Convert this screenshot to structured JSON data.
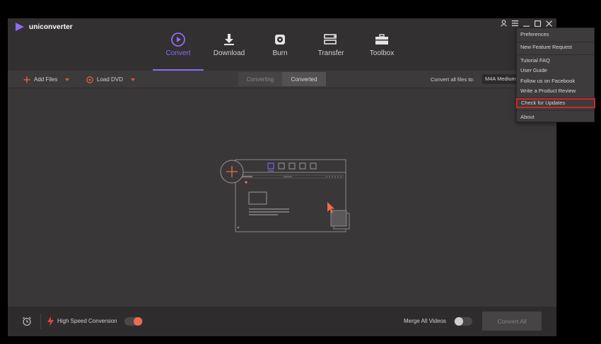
{
  "app": {
    "name": "uniconverter"
  },
  "nav": {
    "items": [
      {
        "label": "Convert",
        "icon": "play-circle-icon",
        "active": true
      },
      {
        "label": "Download",
        "icon": "download-icon"
      },
      {
        "label": "Burn",
        "icon": "disc-icon"
      },
      {
        "label": "Transfer",
        "icon": "transfer-icon"
      },
      {
        "label": "Toolbox",
        "icon": "toolbox-icon"
      }
    ]
  },
  "window_controls": [
    "user-icon",
    "menu-icon",
    "minimize-icon",
    "maximize-icon",
    "close-icon"
  ],
  "toolbar": {
    "add_files": "Add Files",
    "load_dvd": "Load DVD",
    "tabs": [
      "Converting",
      "Converted"
    ],
    "active_tab": "Converted",
    "convert_all_to_label": "Convert all files to:",
    "format_value": "M4A Medium"
  },
  "bottom": {
    "high_speed_label": "High Speed Conversion",
    "high_speed_on": true,
    "merge_label": "Merge All Videos",
    "merge_on": false,
    "convert_all_button": "Convert All"
  },
  "menu": {
    "items": [
      "Preferences",
      "New Feature Request",
      "Tutorial FAQ",
      "User Guide",
      "Follow us on Facebook",
      "Write a Product Review",
      "Check for Updates",
      "About"
    ],
    "highlighted": "Check for Updates"
  },
  "colors": {
    "accent_purple": "#8b6cf4",
    "accent_orange": "#f26a4f",
    "highlight_red": "#c8282e",
    "app_bg": "#3a3738"
  }
}
